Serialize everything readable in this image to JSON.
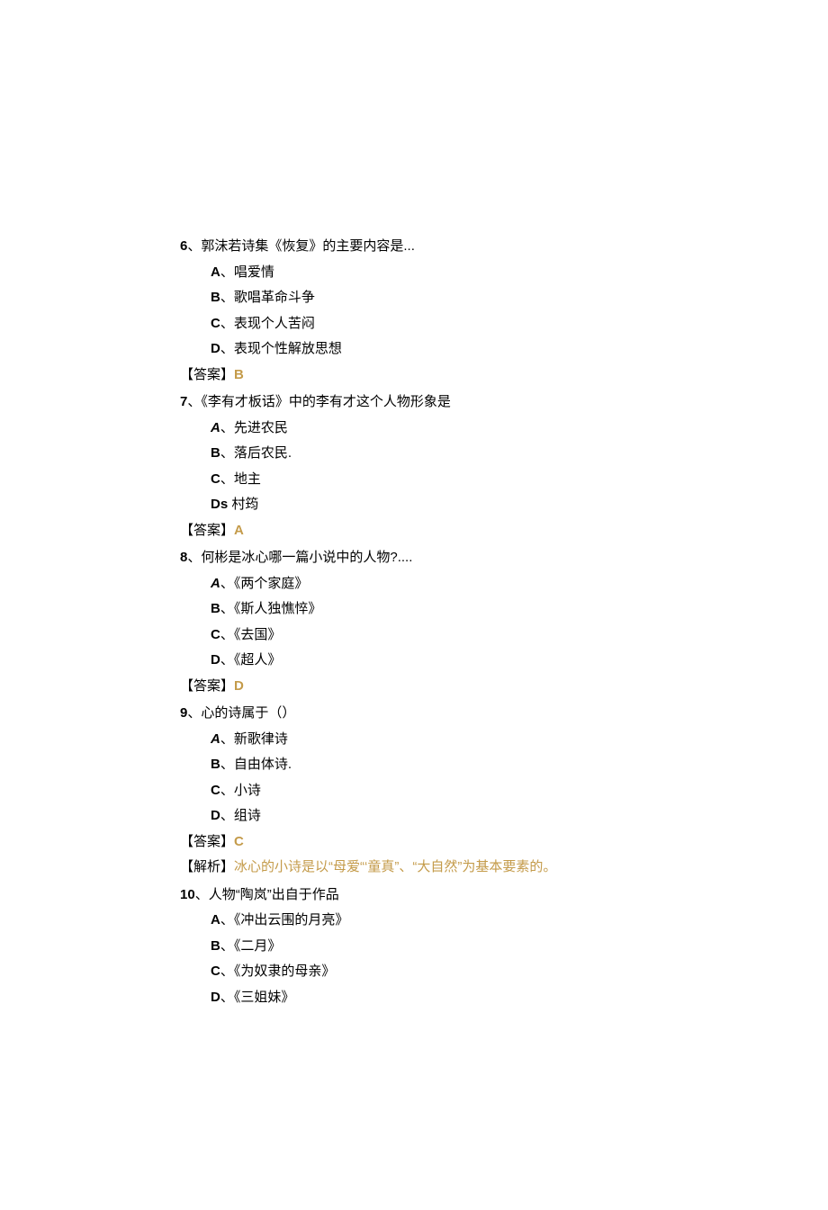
{
  "labels": {
    "answer_prefix": "【答案】",
    "explain_prefix": "【解析】"
  },
  "questions": [
    {
      "num": "6",
      "sep": "、",
      "text": "郭沫若诗集《恢复》的主要内容是...",
      "opts": [
        {
          "label": "A",
          "sep": "、",
          "italic": false,
          "text": "唱爱情"
        },
        {
          "label": "B",
          "sep": "、",
          "italic": false,
          "text": "歌唱革命斗争"
        },
        {
          "label": "C",
          "sep": "、",
          "italic": false,
          "text": "表现个人苦闷"
        },
        {
          "label": "D",
          "sep": "、",
          "italic": false,
          "text": "表现个性解放思想"
        }
      ],
      "answer": "B"
    },
    {
      "num": "7",
      "sep": "、",
      "text": "《李有才板话》中的李有才这个人物形象是",
      "opts": [
        {
          "label": "A",
          "sep": "、",
          "italic": true,
          "text": "先进农民"
        },
        {
          "label": "B",
          "sep": "、",
          "italic": false,
          "text": "落后农民."
        },
        {
          "label": "C",
          "sep": "、",
          "italic": false,
          "text": "地主"
        },
        {
          "label": "Ds",
          "sep": " ",
          "italic": false,
          "text": "村筠"
        }
      ],
      "answer": "A"
    },
    {
      "num": "8",
      "sep": "、",
      "text": "何彬是冰心哪一篇小说中的人物?....",
      "opts": [
        {
          "label": "A",
          "sep": "、",
          "italic": true,
          "text": "《两个家庭》"
        },
        {
          "label": "B",
          "sep": "、",
          "italic": false,
          "text": "《斯人独憔悴》"
        },
        {
          "label": "C",
          "sep": "、",
          "italic": false,
          "text": "《去国》"
        },
        {
          "label": "D",
          "sep": "、",
          "italic": false,
          "text": "《超人》"
        }
      ],
      "answer": "D"
    },
    {
      "num": "9",
      "sep": "、",
      "text": "心的诗属于（）",
      "opts": [
        {
          "label": "A",
          "sep": "、",
          "italic": true,
          "text": "新歌律诗"
        },
        {
          "label": "B",
          "sep": "、",
          "italic": false,
          "text": "自由体诗."
        },
        {
          "label": "C",
          "sep": "、",
          "italic": false,
          "text": "小诗"
        },
        {
          "label": "D",
          "sep": "、",
          "italic": false,
          "text": "组诗"
        }
      ],
      "answer": "C",
      "explain": "冰心的小诗是以“母爱“‘童真”、“大自然”为基本要素的。"
    },
    {
      "num": "10",
      "sep": "、",
      "text": "人物“陶岚”出自于作品",
      "opts": [
        {
          "label": "A",
          "sep": "、",
          "italic": false,
          "text": "《冲出云围的月亮》"
        },
        {
          "label": "B",
          "sep": "、",
          "italic": false,
          "text": "《二月》"
        },
        {
          "label": "C",
          "sep": "、",
          "italic": false,
          "text": "《为奴隶的母亲》"
        },
        {
          "label": "D",
          "sep": "、",
          "italic": false,
          "text": "《三姐妹》"
        }
      ]
    }
  ]
}
